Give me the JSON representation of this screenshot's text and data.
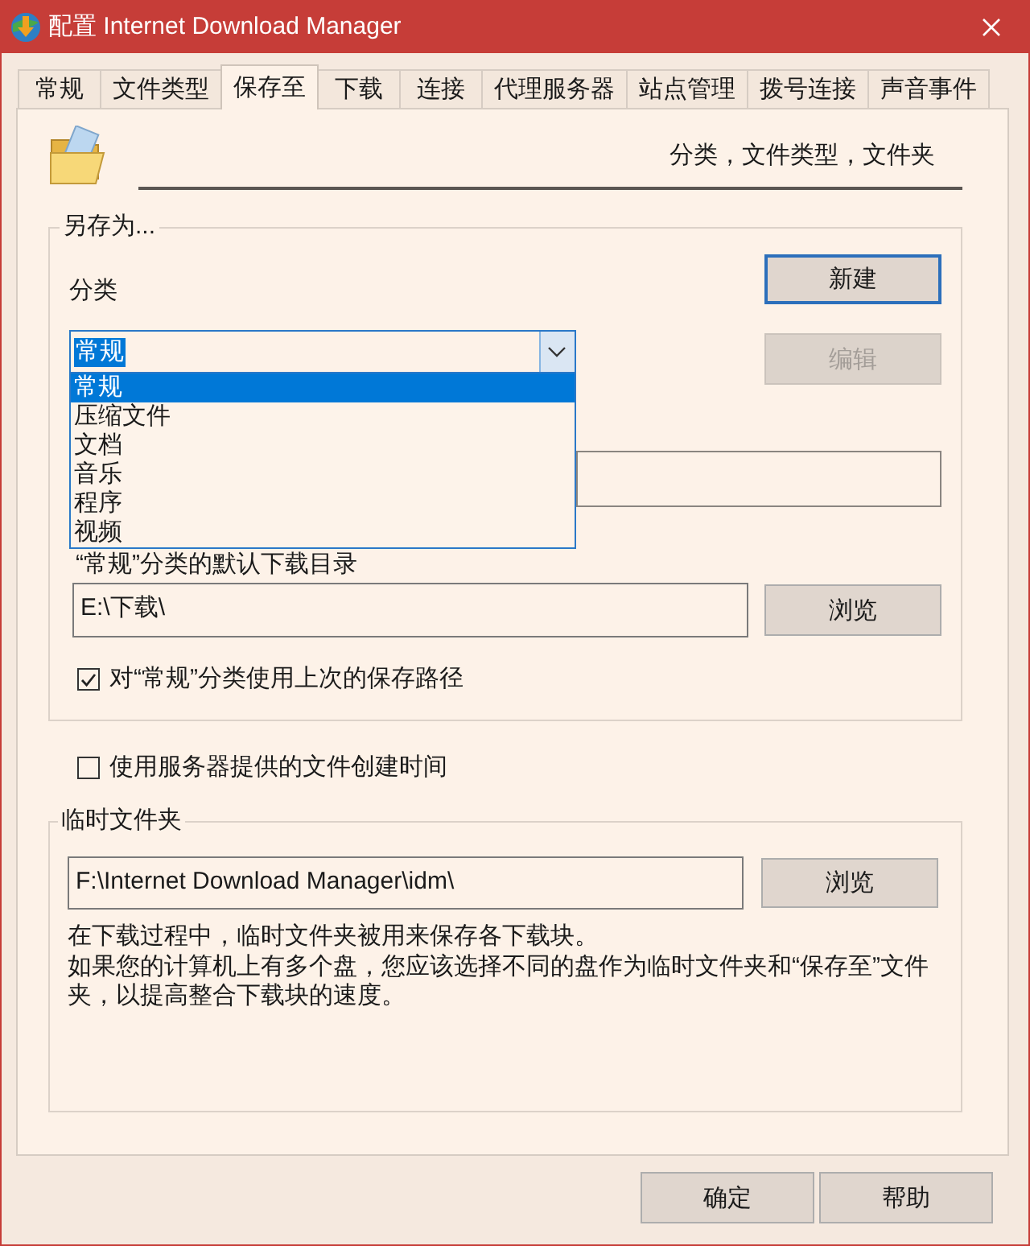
{
  "window": {
    "title": "配置 Internet Download Manager"
  },
  "tabs": [
    {
      "label": "常规",
      "selected": false
    },
    {
      "label": "文件类型",
      "selected": false
    },
    {
      "label": "保存至",
      "selected": true
    },
    {
      "label": "下载",
      "selected": false
    },
    {
      "label": "连接",
      "selected": false
    },
    {
      "label": "代理服务器",
      "selected": false
    },
    {
      "label": "站点管理",
      "selected": false
    },
    {
      "label": "拨号连接",
      "selected": false
    },
    {
      "label": "声音事件",
      "selected": false
    }
  ],
  "header": {
    "text": "分类，文件类型，文件夹"
  },
  "save_as": {
    "legend": "另存为...",
    "category_label": "分类",
    "category": {
      "value": "常规",
      "focused": true,
      "expanded": true,
      "options": [
        {
          "label": "常规",
          "selected": true
        },
        {
          "label": "压缩文件",
          "selected": false
        },
        {
          "label": "文档",
          "selected": false
        },
        {
          "label": "音乐",
          "selected": false
        },
        {
          "label": "程序",
          "selected": false
        },
        {
          "label": "视频",
          "selected": false
        }
      ]
    },
    "buttons": [
      {
        "label": "新建",
        "default": true,
        "disabled": false
      },
      {
        "label": "编辑",
        "default": false,
        "disabled": true
      }
    ],
    "default_dir_label": "“常规”分类的默认下载目录",
    "default_dir": "E:\\下载\\",
    "browse_label": "浏览",
    "use_last_path": {
      "label": "对“常规”分类使用上次的保存路径",
      "checked": true
    }
  },
  "use_server_time": {
    "label": "使用服务器提供的文件创建时间",
    "checked": false
  },
  "temp_folder": {
    "legend": "临时文件夹",
    "path": "F:\\Internet Download Manager\\idm\\",
    "browse_label": "浏览",
    "note": [
      "在下载过程中，临时文件夹被用来保存各下载块。",
      "如果您的计算机上有多个盘，您应该选择不同的盘作为临时文件夹和“保存至”文件夹，以提高整合下载块的速度。"
    ]
  },
  "buttons": [
    {
      "label": "确定"
    },
    {
      "label": "帮助"
    }
  ]
}
